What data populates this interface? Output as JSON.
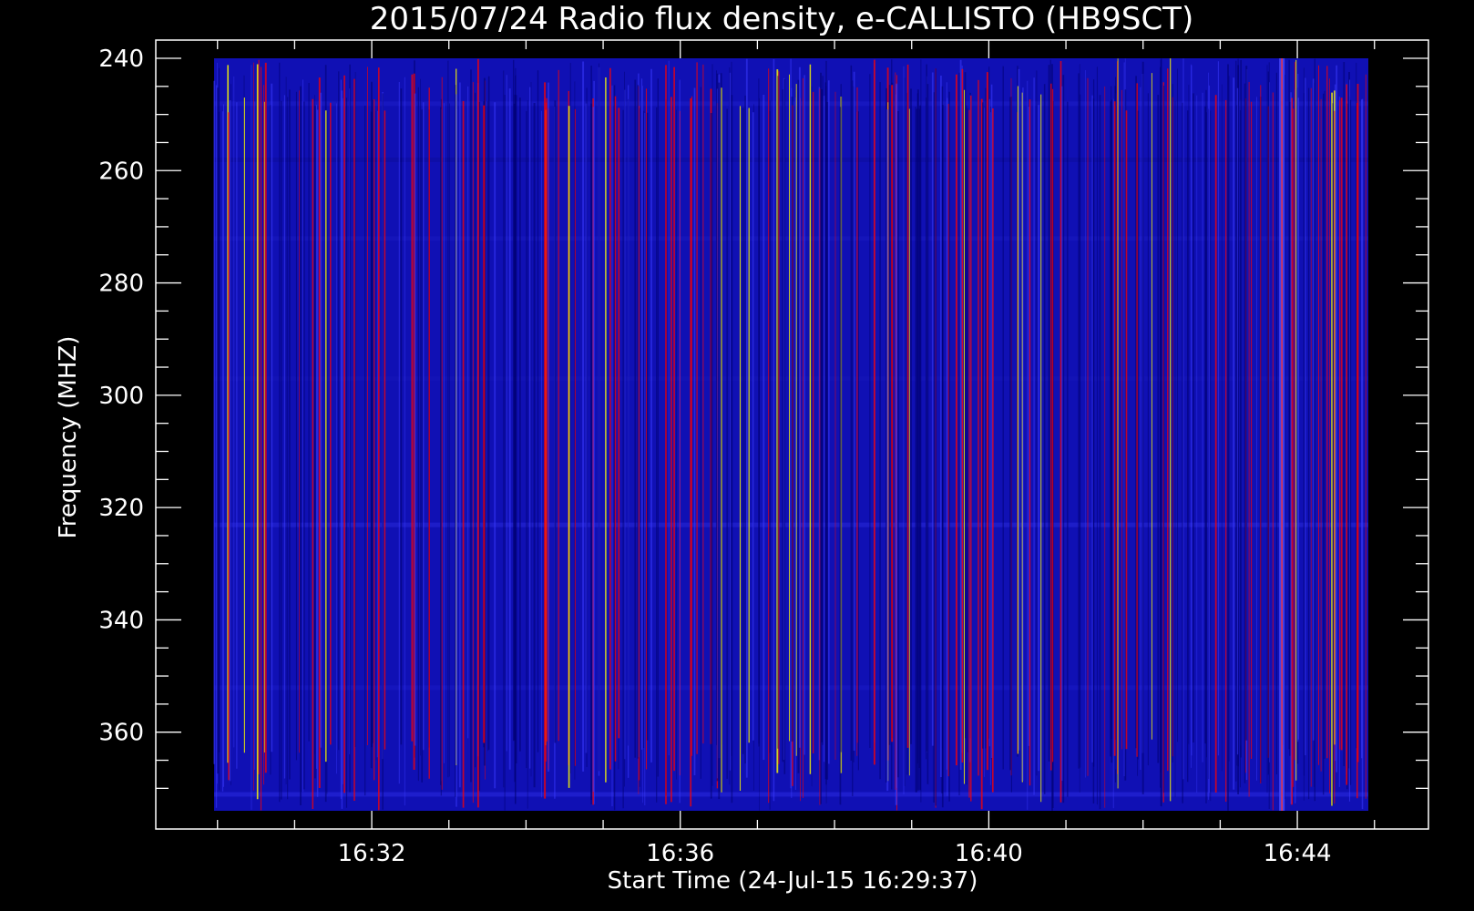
{
  "chart_data": {
    "type": "heatmap",
    "title": "2015/07/24  Radio flux density, e-CALLISTO (HB9SCT)",
    "xlabel": "Start Time (24-Jul-15 16:29:37)",
    "ylabel": "Frequency (MHZ)",
    "x_start": "16:29:37",
    "x_end": "16:45:00",
    "xlim_minutes": [
      29.2,
      45.7
    ],
    "ylim": [
      240,
      374
    ],
    "y_inverted": true,
    "x_ticks": [
      "16:32",
      "16:36",
      "16:40",
      "16:44"
    ],
    "x_tick_minutes": [
      32,
      36,
      40,
      44
    ],
    "y_ticks": [
      240,
      260,
      280,
      300,
      320,
      340,
      360
    ],
    "colormap": [
      "#000000",
      "#0000c8",
      "#3a3aff",
      "#ff0000",
      "#ffff00"
    ],
    "background_color": "#1010b4",
    "burst_minute": 43.8
  }
}
